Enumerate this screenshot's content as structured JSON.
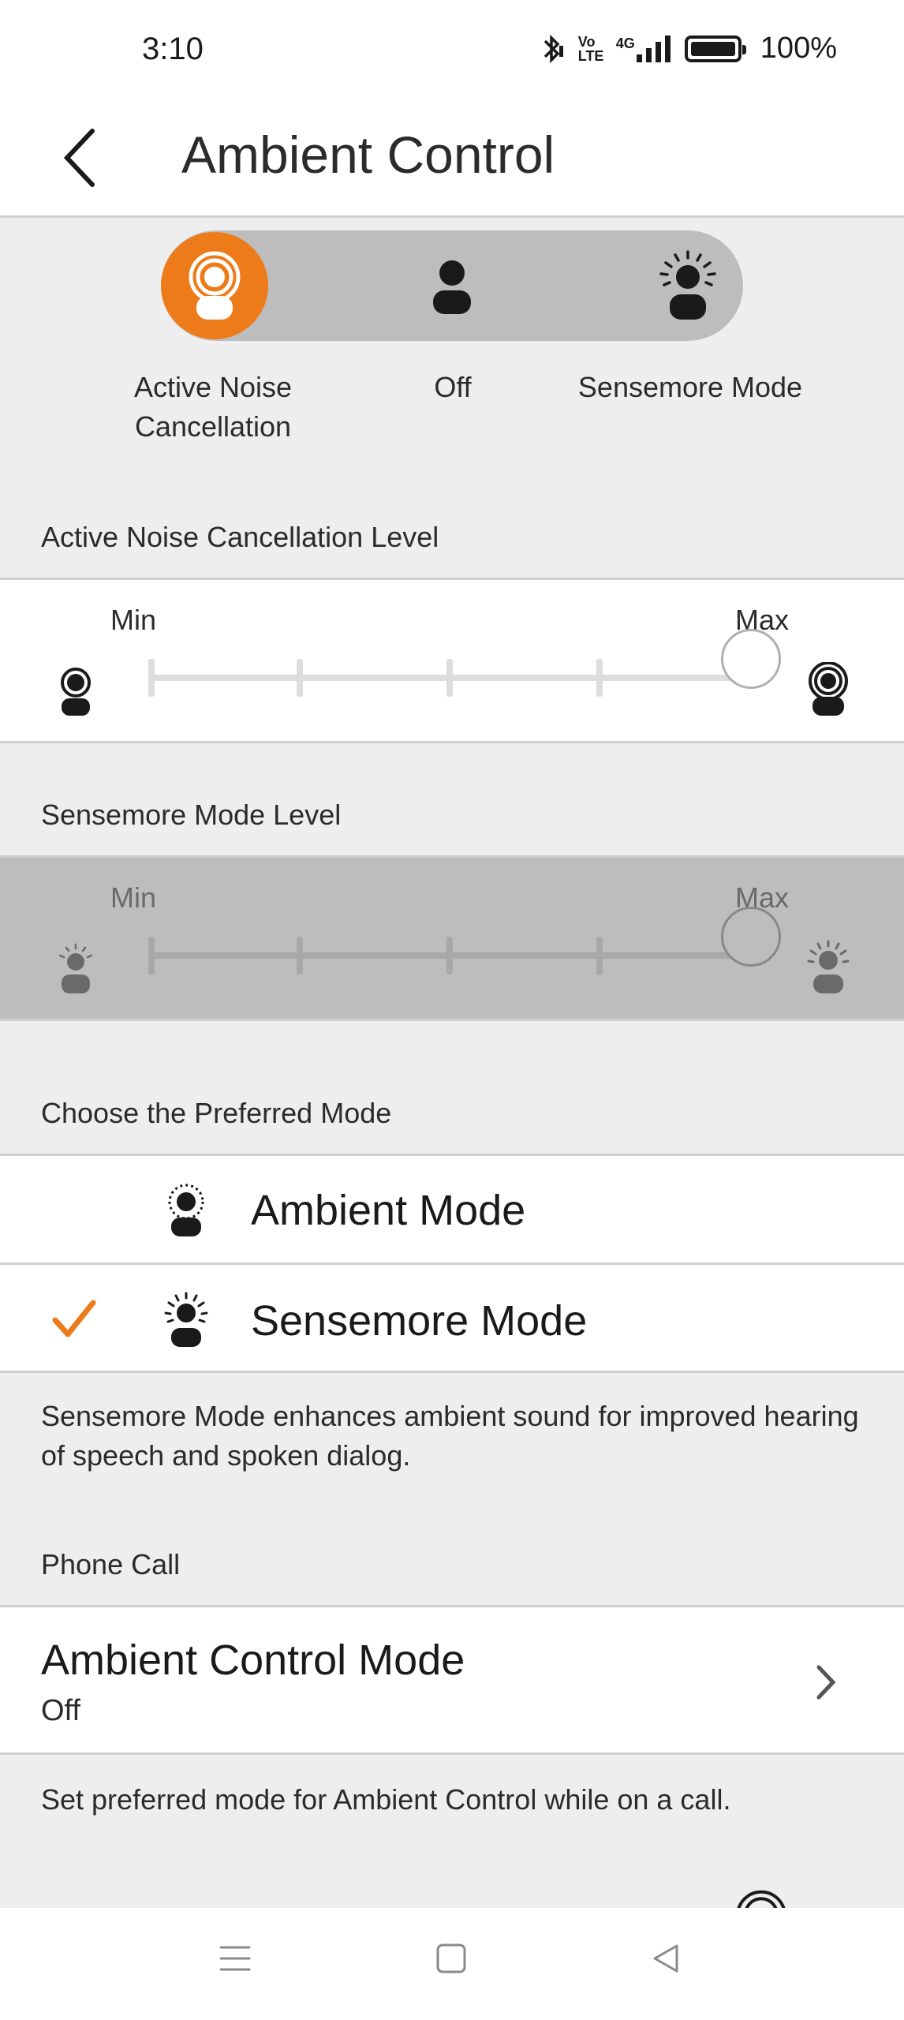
{
  "status_bar": {
    "time": "3:10",
    "battery_percent": "100%",
    "network": "4G",
    "volte": "Vo LTE"
  },
  "header": {
    "title": "Ambient Control"
  },
  "mode_selector": {
    "selected": "Active Noise Cancellation",
    "accent_color": "#ee7b1a",
    "modes": [
      {
        "label": "Active Noise Cancellation",
        "line1": "Active Noise",
        "line2": "Cancellation"
      },
      {
        "label": "Off"
      },
      {
        "label": "Sensemore Mode"
      }
    ]
  },
  "anc_level": {
    "section_label": "Active Noise Cancellation Level",
    "min_label": "Min",
    "max_label": "Max",
    "value_fraction": 1.0
  },
  "sensemore_level": {
    "section_label": "Sensemore Mode Level",
    "min_label": "Min",
    "max_label": "Max",
    "value_fraction": 1.0,
    "disabled": true
  },
  "preferred_mode": {
    "section_label": "Choose the Preferred Mode",
    "options": [
      {
        "label": "Ambient Mode",
        "selected": false
      },
      {
        "label": "Sensemore Mode",
        "selected": true
      }
    ],
    "description": "Sensemore Mode enhances ambient sound for improved hearing of speech and spoken dialog."
  },
  "phone_call": {
    "section_label": "Phone Call",
    "row_title": "Ambient Control Mode",
    "row_value": "Off",
    "description": "Set preferred mode for Ambient Control while on a call."
  }
}
